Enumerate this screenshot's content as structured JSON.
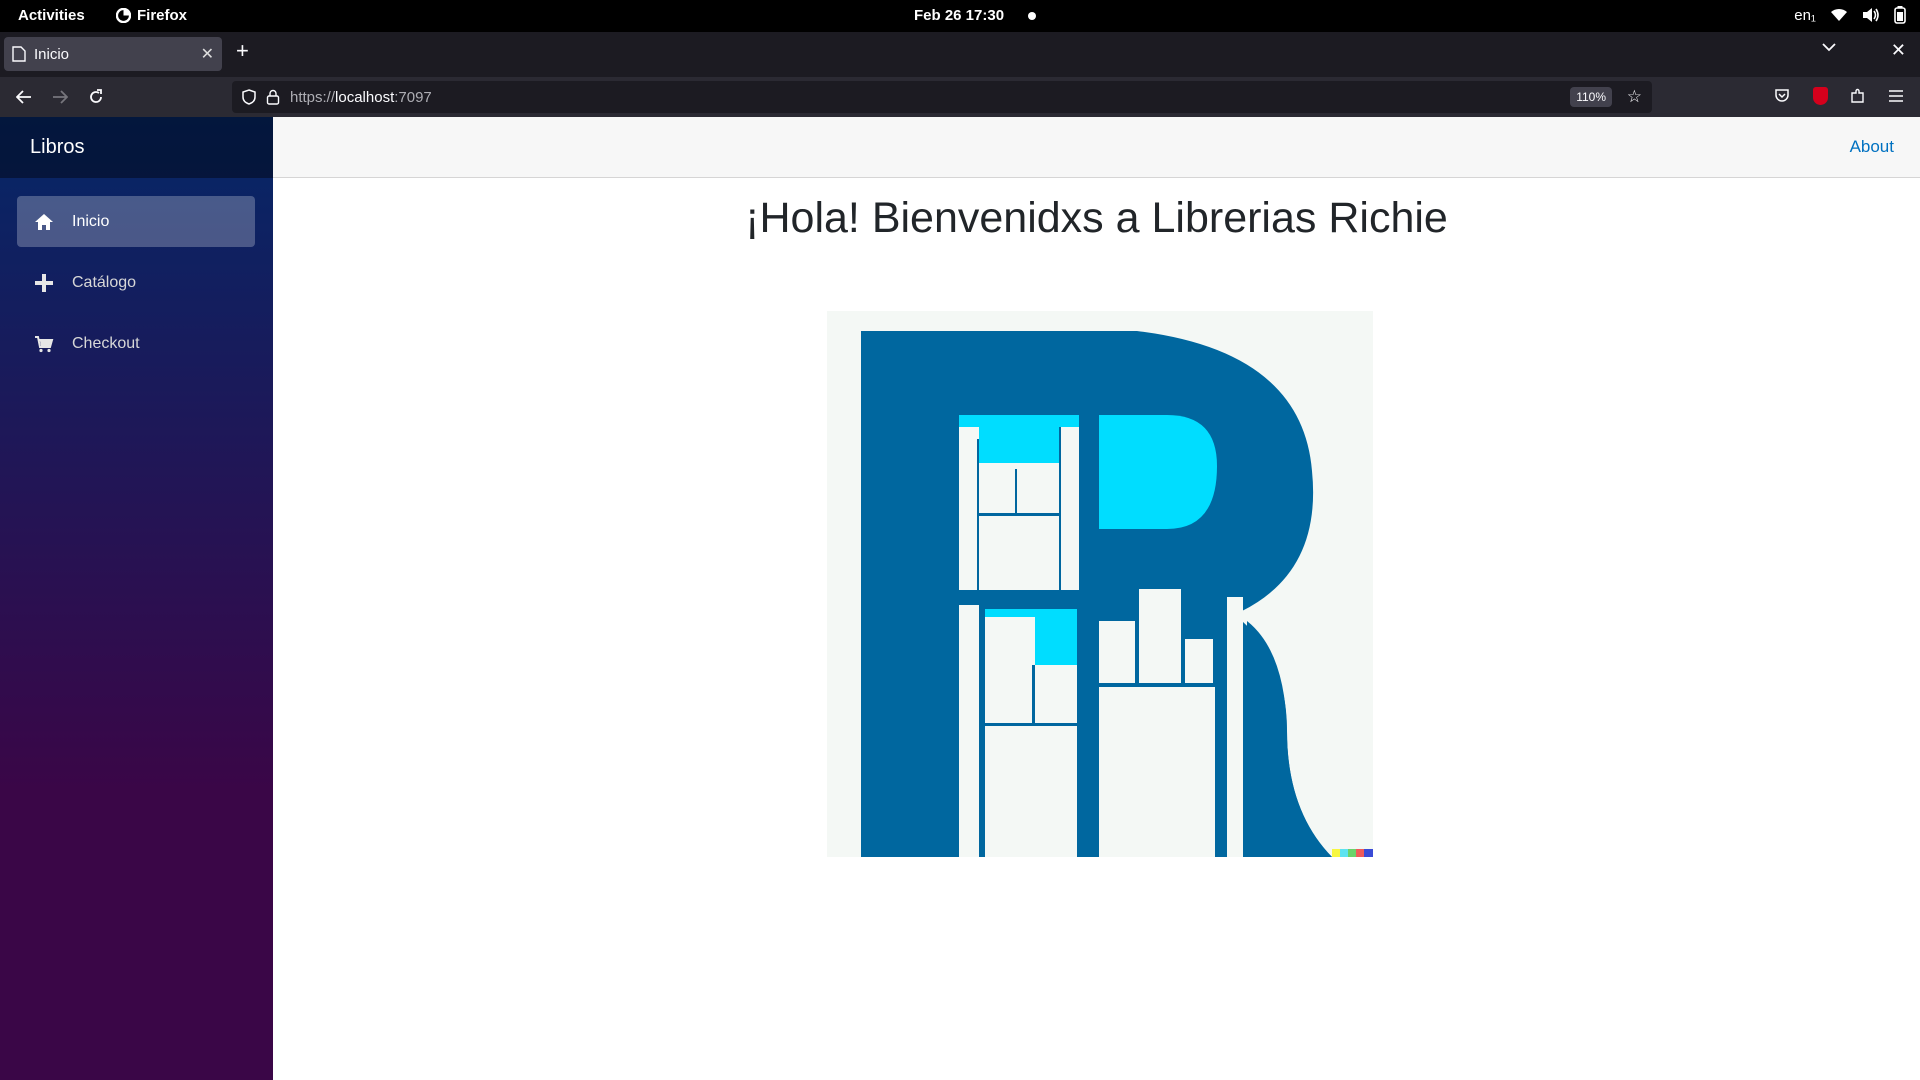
{
  "system": {
    "activities": "Activities",
    "app_name": "Firefox",
    "clock": "Feb 26  17:30",
    "lang": "en₁"
  },
  "browser": {
    "tab_title": "Inicio",
    "url_scheme": "https://",
    "url_host": "localhost",
    "url_port": ":7097",
    "zoom": "110%"
  },
  "sidebar": {
    "brand": "Libros",
    "items": [
      {
        "label": "Inicio",
        "icon": "home-icon",
        "active": true
      },
      {
        "label": "Catálogo",
        "icon": "plus-icon",
        "active": false
      },
      {
        "label": "Checkout",
        "icon": "cart-icon",
        "active": false
      }
    ]
  },
  "header": {
    "about_link": "About"
  },
  "main": {
    "heading": "¡Hola! Bienvenidxs a Librerias Richie",
    "logo_colors": {
      "dark": "#00679f",
      "light": "#00ddff",
      "bg": "#f4f8f5"
    }
  }
}
